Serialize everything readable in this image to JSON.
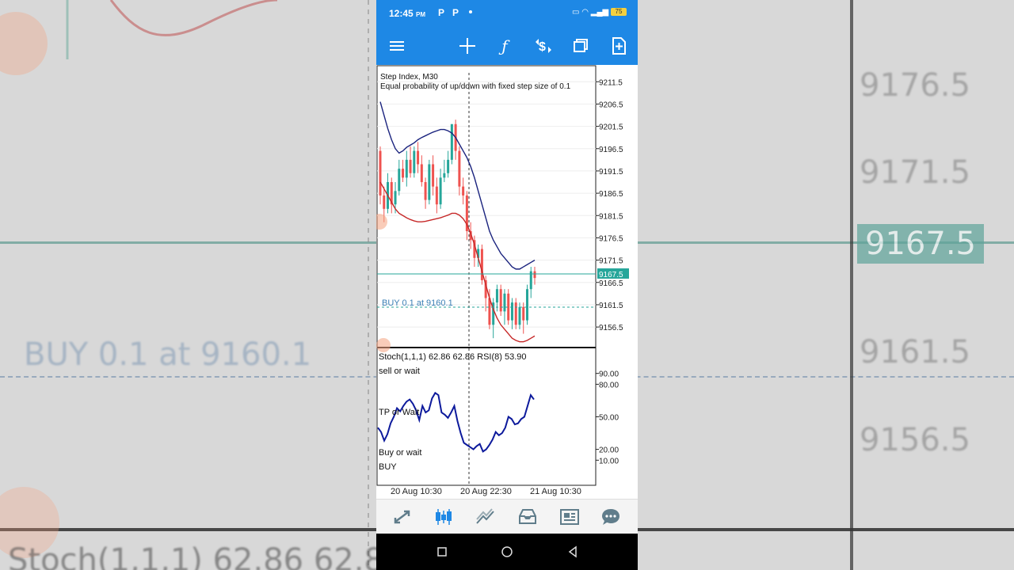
{
  "status_bar": {
    "time": "12:45",
    "ampm": "PM",
    "notif1": "P",
    "notif2": "P",
    "battery": "75"
  },
  "toolbar": {
    "icons": [
      "menu-icon",
      "crosshair-icon",
      "indicators-icon",
      "symbol-icon",
      "windows-icon",
      "new-order-icon"
    ]
  },
  "chart": {
    "title": "Step Index, M30",
    "subtitle": "Equal probability of up/down with fixed step size of 0.1",
    "price_ticks": [
      "9211.5",
      "9206.5",
      "9201.5",
      "9196.5",
      "9191.5",
      "9186.5",
      "9181.5",
      "9176.5",
      "9171.5",
      "9166.5",
      "9161.5",
      "9156.5"
    ],
    "current_price": "9167.5",
    "order_label": "BUY 0.1 at 9160.1",
    "indicator_header": "Stoch(1,1,1) 62.86 62.86 RSI(8) 53.90",
    "indicator_ticks": [
      "90.00",
      "80.00",
      "50.00",
      "20.00",
      "10.00"
    ],
    "zone_labels": [
      "sell or wait",
      "TP or Wait",
      "Buy or wait",
      "BUY"
    ],
    "time_labels": [
      "20 Aug 10:30",
      "20 Aug 22:30",
      "21 Aug 10:30"
    ],
    "colors": {
      "bull": "#26a69a",
      "bear": "#ef5350",
      "upper_band": "#1a237e",
      "lower_band": "#c62828",
      "oscillator": "#0d1a9c",
      "price_line": "#26a69a",
      "accent": "#1e88e5"
    }
  },
  "chart_data": {
    "type": "line",
    "symbol": "Step Index",
    "timeframe": "M30",
    "ylim": [
      9153.5,
      9213.5
    ],
    "current_price": 9167.5,
    "buy_level": 9160.1,
    "candles": [
      {
        "o": 9196,
        "c": 9186,
        "h": 9197,
        "l": 9184
      },
      {
        "o": 9186,
        "c": 9183,
        "h": 9188,
        "l": 9180
      },
      {
        "o": 9183,
        "c": 9189,
        "h": 9191,
        "l": 9182
      },
      {
        "o": 9189,
        "c": 9184,
        "h": 9190,
        "l": 9182
      },
      {
        "o": 9184,
        "c": 9187,
        "h": 9189,
        "l": 9182
      },
      {
        "o": 9187,
        "c": 9192,
        "h": 9194,
        "l": 9186
      },
      {
        "o": 9192,
        "c": 9190,
        "h": 9194,
        "l": 9189
      },
      {
        "o": 9190,
        "c": 9194,
        "h": 9196,
        "l": 9188
      },
      {
        "o": 9194,
        "c": 9191,
        "h": 9197,
        "l": 9190
      },
      {
        "o": 9191,
        "c": 9196,
        "h": 9197,
        "l": 9190
      },
      {
        "o": 9196,
        "c": 9193,
        "h": 9198,
        "l": 9191
      },
      {
        "o": 9193,
        "c": 9189,
        "h": 9195,
        "l": 9188
      },
      {
        "o": 9189,
        "c": 9185,
        "h": 9190,
        "l": 9183
      },
      {
        "o": 9185,
        "c": 9193,
        "h": 9194,
        "l": 9184
      },
      {
        "o": 9193,
        "c": 9188,
        "h": 9195,
        "l": 9186
      },
      {
        "o": 9188,
        "c": 9184,
        "h": 9190,
        "l": 9182
      },
      {
        "o": 9184,
        "c": 9190,
        "h": 9192,
        "l": 9183
      },
      {
        "o": 9190,
        "c": 9191,
        "h": 9194,
        "l": 9189
      },
      {
        "o": 9191,
        "c": 9194,
        "h": 9196,
        "l": 9190
      },
      {
        "o": 9194,
        "c": 9202,
        "h": 9202,
        "l": 9193
      },
      {
        "o": 9202,
        "c": 9196,
        "h": 9203,
        "l": 9194
      },
      {
        "o": 9196,
        "c": 9188,
        "h": 9197,
        "l": 9186
      },
      {
        "o": 9188,
        "c": 9186,
        "h": 9190,
        "l": 9184
      },
      {
        "o": 9186,
        "c": 9178,
        "h": 9187,
        "l": 9176
      },
      {
        "o": 9178,
        "c": 9176,
        "h": 9180,
        "l": 9174
      },
      {
        "o": 9176,
        "c": 9172,
        "h": 9177,
        "l": 9170
      },
      {
        "o": 9172,
        "c": 9174,
        "h": 9175,
        "l": 9170
      },
      {
        "o": 9174,
        "c": 9167,
        "h": 9175,
        "l": 9166
      },
      {
        "o": 9167,
        "c": 9163,
        "h": 9168,
        "l": 9160
      },
      {
        "o": 9163,
        "c": 9157,
        "h": 9165,
        "l": 9156
      },
      {
        "o": 9157,
        "c": 9162,
        "h": 9163,
        "l": 9154
      },
      {
        "o": 9162,
        "c": 9165,
        "h": 9166,
        "l": 9160
      },
      {
        "o": 9165,
        "c": 9160,
        "h": 9166,
        "l": 9159
      },
      {
        "o": 9160,
        "c": 9164,
        "h": 9165,
        "l": 9157
      },
      {
        "o": 9164,
        "c": 9158,
        "h": 9165,
        "l": 9157
      },
      {
        "o": 9158,
        "c": 9162,
        "h": 9163,
        "l": 9156
      },
      {
        "o": 9162,
        "c": 9157,
        "h": 9163,
        "l": 9156
      },
      {
        "o": 9157,
        "c": 9161,
        "h": 9162,
        "l": 9156
      },
      {
        "o": 9161,
        "c": 9158,
        "h": 9162,
        "l": 9155
      },
      {
        "o": 9158,
        "c": 9165,
        "h": 9166,
        "l": 9157
      },
      {
        "o": 9165,
        "c": 9169,
        "h": 9170,
        "l": 9163
      },
      {
        "o": 9169,
        "c": 9167.5,
        "h": 9170,
        "l": 9166
      }
    ],
    "upper_band": [
      9207,
      9204,
      9201,
      9198.5,
      9196.5,
      9195.5,
      9196,
      9196.8,
      9197.3,
      9197.8,
      9198.5,
      9199,
      9199.4,
      9199.8,
      9200.2,
      9200.5,
      9200.8,
      9200.8,
      9200.5,
      9200,
      9199,
      9197.5,
      9196,
      9194.5,
      9192.5,
      9190,
      9187,
      9184,
      9181,
      9178,
      9176,
      9174.5,
      9173,
      9172,
      9171,
      9170,
      9169.5,
      9169.5,
      9170,
      9170.5,
      9171,
      9171.5
    ],
    "lower_band": [
      9189,
      9187.5,
      9186,
      9184.5,
      9183,
      9182,
      9181.5,
      9181,
      9180.6,
      9180.3,
      9180.1,
      9180.1,
      9180.2,
      9180.4,
      9180.6,
      9180.8,
      9181,
      9181.3,
      9181.6,
      9182,
      9182,
      9181.6,
      9180.8,
      9179.5,
      9177.5,
      9175,
      9172,
      9169,
      9166,
      9163,
      9160.5,
      9158.5,
      9157,
      9156,
      9155,
      9154,
      9153.5,
      9153.2,
      9153.2,
      9153.5,
      9154,
      9154.5
    ],
    "oscillator_ylim": [
      0,
      100
    ],
    "oscillator": [
      40,
      36,
      28,
      34,
      44,
      50,
      58,
      55,
      60,
      64,
      66,
      62,
      56,
      47,
      60,
      54,
      56,
      67,
      72,
      70,
      54,
      52,
      49,
      54,
      60,
      46,
      35,
      26,
      24,
      22,
      20,
      23,
      25,
      18,
      20,
      24,
      29,
      36,
      33,
      35,
      40,
      50,
      48,
      43,
      44,
      48,
      50,
      60,
      70,
      66
    ]
  },
  "bottom_nav": {
    "icons": [
      "quotes-icon",
      "chart-icon",
      "trade-icon",
      "history-icon",
      "news-icon",
      "messages-icon"
    ]
  },
  "background": {
    "labels": [
      "9176.5",
      "9171.5",
      "9167.5",
      "9161.5",
      "9156.5",
      "BUY 0.1 at 9160.1",
      "Stoch(1,1,1) 62.86 62.8"
    ]
  }
}
